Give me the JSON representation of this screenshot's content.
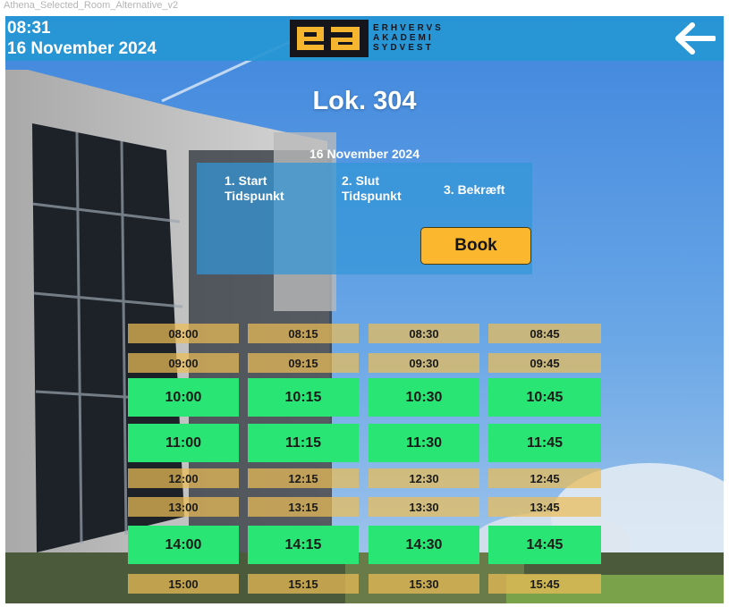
{
  "frame_title": "Athena_Selected_Room_Alternative_v2",
  "header": {
    "time": "08:31",
    "date": "16 November 2024",
    "logo_lines": [
      "ERHVERVS",
      "AKADEMI",
      "SYDVEST"
    ],
    "back_icon": "arrow-left-icon"
  },
  "room": {
    "name": "Lok. 304",
    "date": "16 November 2024"
  },
  "steps": [
    {
      "label": "1. Start Tidspunkt"
    },
    {
      "label": "2. Slut Tidspunkt"
    },
    {
      "label": "3. Bekræft"
    }
  ],
  "book_label": "Book",
  "colors": {
    "header": "#2696d4",
    "available": "#29e574",
    "booked": "#ecbc56",
    "book_button": "#fbb82f"
  },
  "slots": {
    "s0800": {
      "label": "08:00",
      "available": false
    },
    "s0815": {
      "label": "08:15",
      "available": false
    },
    "s0830": {
      "label": "08:30",
      "available": false
    },
    "s0845": {
      "label": "08:45",
      "available": false
    },
    "s0900": {
      "label": "09:00",
      "available": false
    },
    "s0915": {
      "label": "09:15",
      "available": false
    },
    "s0930": {
      "label": "09:30",
      "available": false
    },
    "s0945": {
      "label": "09:45",
      "available": false
    },
    "s1000": {
      "label": "10:00",
      "available": true
    },
    "s1015": {
      "label": "10:15",
      "available": true
    },
    "s1030": {
      "label": "10:30",
      "available": true
    },
    "s1045": {
      "label": "10:45",
      "available": true
    },
    "s1100": {
      "label": "11:00",
      "available": true
    },
    "s1115": {
      "label": "11:15",
      "available": true
    },
    "s1130": {
      "label": "11:30",
      "available": true
    },
    "s1145": {
      "label": "11:45",
      "available": true
    },
    "s1200": {
      "label": "12:00",
      "available": false
    },
    "s1215": {
      "label": "12:15",
      "available": false
    },
    "s1230": {
      "label": "12:30",
      "available": false
    },
    "s1245": {
      "label": "12:45",
      "available": false
    },
    "s1300": {
      "label": "13:00",
      "available": false
    },
    "s1315": {
      "label": "13:15",
      "available": false
    },
    "s1330": {
      "label": "13:30",
      "available": false
    },
    "s1345": {
      "label": "13:45",
      "available": false
    },
    "s1400": {
      "label": "14:00",
      "available": true
    },
    "s1415": {
      "label": "14:15",
      "available": true
    },
    "s1430": {
      "label": "14:30",
      "available": true
    },
    "s1445": {
      "label": "14:45",
      "available": true
    },
    "s1500": {
      "label": "15:00",
      "available": false
    },
    "s1515": {
      "label": "15:15",
      "available": false
    },
    "s1530": {
      "label": "15:30",
      "available": false
    },
    "s1545": {
      "label": "15:45",
      "available": false
    }
  }
}
